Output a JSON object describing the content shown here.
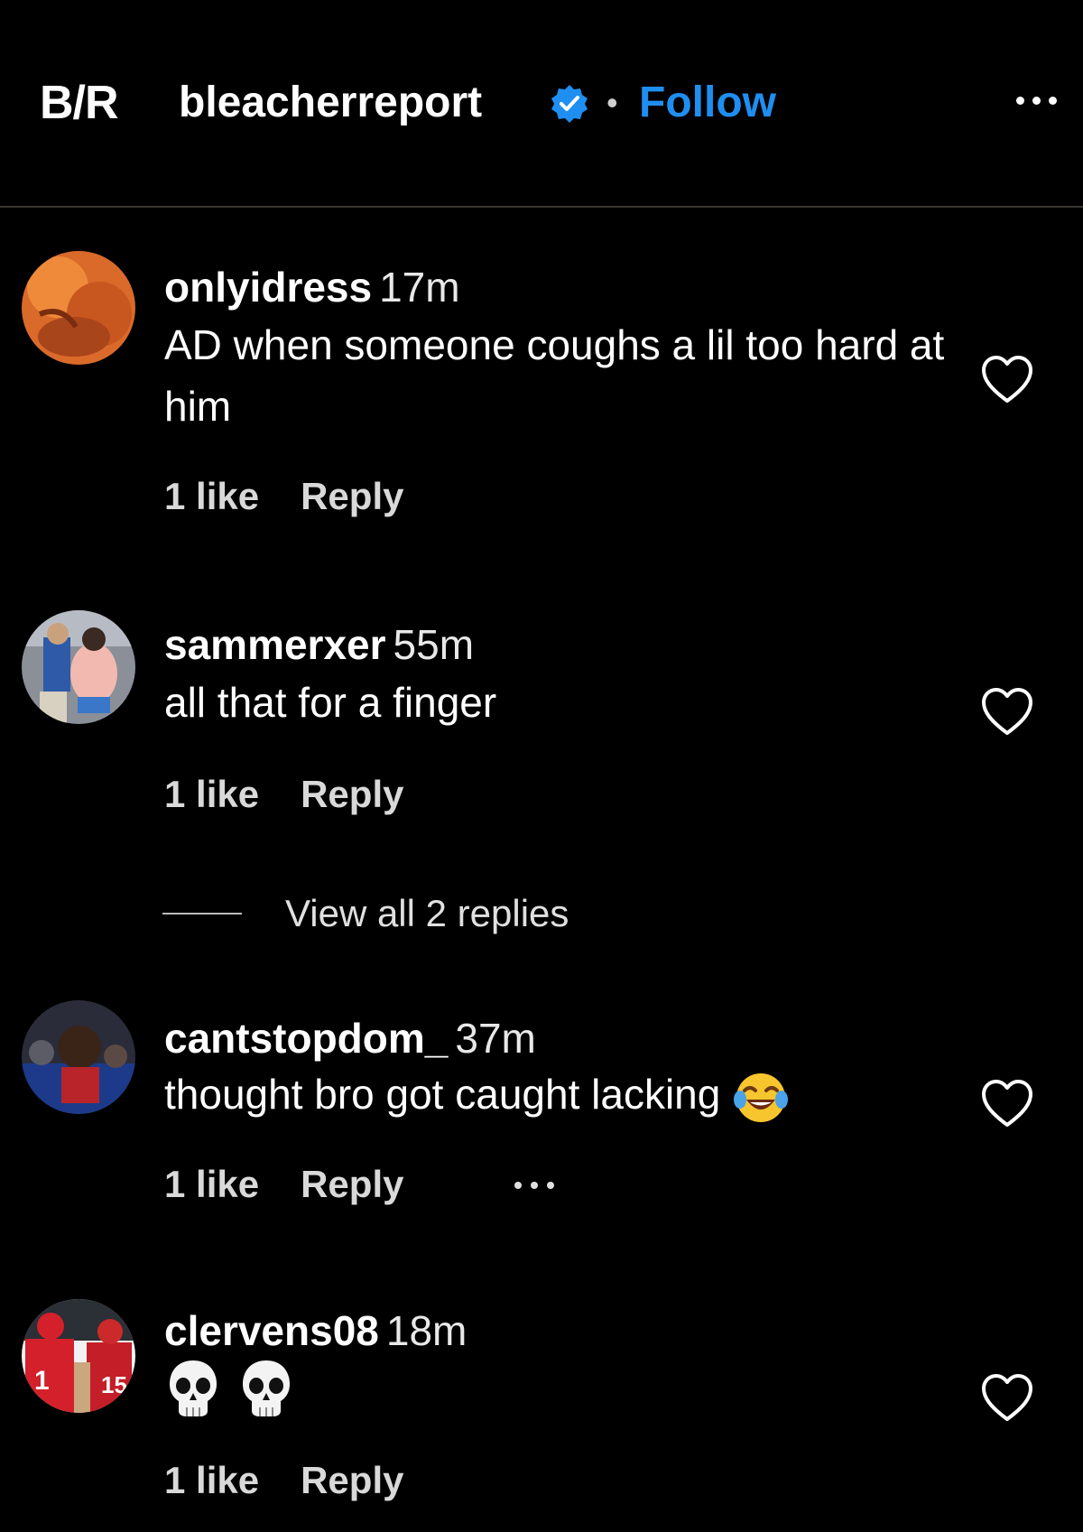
{
  "header": {
    "logo_text": "B/R",
    "username": "bleacherreport",
    "separator": "•",
    "follow_label": "Follow"
  },
  "comments": [
    {
      "username": "onlyidress",
      "time": "17m",
      "text": "AD when someone coughs a lil too hard at him",
      "likes": "1 like",
      "reply_label": "Reply"
    },
    {
      "username": "sammerxer",
      "time": "55m",
      "text": "all that for a finger",
      "likes": "1 like",
      "reply_label": "Reply"
    },
    {
      "username": "cantstopdom_",
      "time": "37m",
      "text": "thought bro got caught lacking",
      "emoji_icon": "face-with-tears-of-joy-icon",
      "likes": "1 like",
      "reply_label": "Reply"
    },
    {
      "username": "clervens08",
      "time": "18m",
      "emoji_icon": "skull-icon",
      "likes": "1 like",
      "reply_label": "Reply"
    }
  ],
  "view_replies_label": "View all 2 replies",
  "colors": {
    "background": "#000000",
    "accent": "#1f8ef1",
    "verified": "#1f8ef1"
  }
}
